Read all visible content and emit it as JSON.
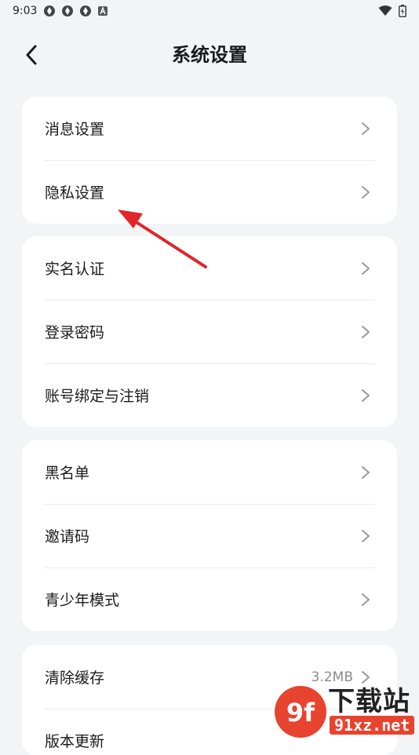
{
  "status_bar": {
    "time": "9:03",
    "notification_icons": [
      "app-notification-icon",
      "app-notification-icon",
      "app-notification-icon",
      "a-notification-icon"
    ],
    "right_icons": [
      "wifi-icon",
      "battery-icon"
    ]
  },
  "header": {
    "title": "系统设置",
    "back_icon": "chevron-left-icon"
  },
  "groups": [
    {
      "items": [
        {
          "label": "消息设置"
        },
        {
          "label": "隐私设置"
        }
      ]
    },
    {
      "items": [
        {
          "label": "实名认证"
        },
        {
          "label": "登录密码"
        },
        {
          "label": "账号绑定与注销"
        }
      ]
    },
    {
      "items": [
        {
          "label": "黑名单"
        },
        {
          "label": "邀请码"
        },
        {
          "label": "青少年模式"
        }
      ]
    },
    {
      "items": [
        {
          "label": "清除缓存",
          "value": "3.2MB"
        },
        {
          "label": "版本更新"
        }
      ]
    }
  ],
  "annotation": {
    "arrow_color": "#e0262a",
    "target": "隐私设置"
  },
  "watermark": {
    "logo_text": "9f",
    "title": "下载站",
    "url": "91xz.net",
    "accent": "#e8432f"
  },
  "colors": {
    "background": "#f3f4f6",
    "card": "#ffffff",
    "divider": "#ececec",
    "chevron": "#9a9a9a"
  }
}
